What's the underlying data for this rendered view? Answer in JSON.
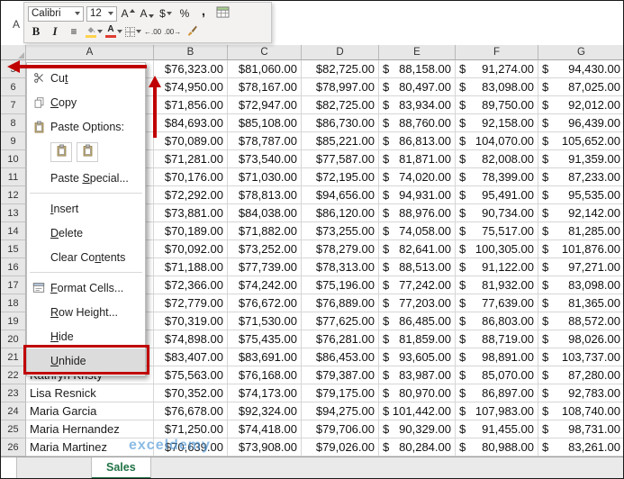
{
  "name_box_fragment": "A",
  "mini_toolbar": {
    "font_name": "Calibri",
    "font_size": "12",
    "grow_font": "A",
    "shrink_font": "A",
    "currency": "$",
    "percent": "%",
    "comma": ",",
    "bold": "B",
    "italic": "I",
    "font_color_letter": "A",
    "increase_decimal": "←.00",
    "decrease_decimal": ".00→"
  },
  "context_menu": {
    "items": [
      {
        "label": "Cut",
        "icon": "scissors",
        "u": 2
      },
      {
        "label": "Copy",
        "icon": "copy",
        "u": 0
      },
      {
        "label": "Paste Options:",
        "icon": "clipboard"
      },
      {
        "type": "paste-icons",
        "options": [
          "paste-keep-formatting",
          "paste-values"
        ]
      },
      {
        "label": "Paste Special...",
        "u": 6
      },
      {
        "type": "sep"
      },
      {
        "label": "Insert",
        "u": 0
      },
      {
        "label": "Delete",
        "u": 0
      },
      {
        "label": "Clear Contents",
        "u": 8
      },
      {
        "type": "sep"
      },
      {
        "label": "Format Cells...",
        "icon": "dialog",
        "u": 0
      },
      {
        "label": "Row Height...",
        "u": 0
      },
      {
        "label": "Hide",
        "u": 0
      },
      {
        "label": "Unhide",
        "u": 0,
        "highlighted": true
      }
    ]
  },
  "grid": {
    "columns": [
      "A",
      "B",
      "C",
      "D",
      "E",
      "F",
      "G"
    ],
    "rows": [
      {
        "n": 5,
        "name": "",
        "values": [
          "76,323.00",
          "81,060.00",
          "82,725.00",
          "88,158.00",
          "91,274.00",
          "94,430.00"
        ]
      },
      {
        "n": 6,
        "name": "",
        "values": [
          "74,950.00",
          "78,167.00",
          "78,997.00",
          "80,497.00",
          "83,098.00",
          "87,025.00"
        ]
      },
      {
        "n": 7,
        "name": "",
        "values": [
          "71,856.00",
          "72,947.00",
          "82,725.00",
          "83,934.00",
          "89,750.00",
          "92,012.00"
        ]
      },
      {
        "n": 8,
        "name": "",
        "values": [
          "84,693.00",
          "85,108.00",
          "86,730.00",
          "88,760.00",
          "92,158.00",
          "96,439.00"
        ]
      },
      {
        "n": 9,
        "name": "",
        "values": [
          "70,089.00",
          "78,787.00",
          "85,221.00",
          "86,813.00",
          "104,070.00",
          "105,652.00"
        ]
      },
      {
        "n": 10,
        "name": "",
        "values": [
          "71,281.00",
          "73,540.00",
          "77,587.00",
          "81,871.00",
          "82,008.00",
          "91,359.00"
        ]
      },
      {
        "n": 11,
        "name": "",
        "values": [
          "70,176.00",
          "71,030.00",
          "72,195.00",
          "74,020.00",
          "78,399.00",
          "87,233.00"
        ]
      },
      {
        "n": 12,
        "name": "",
        "values": [
          "72,292.00",
          "78,813.00",
          "94,656.00",
          "94,931.00",
          "95,491.00",
          "95,535.00"
        ]
      },
      {
        "n": 13,
        "name": "",
        "values": [
          "73,881.00",
          "84,038.00",
          "86,120.00",
          "88,976.00",
          "90,734.00",
          "92,142.00"
        ]
      },
      {
        "n": 14,
        "name": "",
        "values": [
          "70,189.00",
          "71,882.00",
          "73,255.00",
          "74,058.00",
          "75,517.00",
          "81,285.00"
        ]
      },
      {
        "n": 15,
        "name": "",
        "values": [
          "70,092.00",
          "73,252.00",
          "78,279.00",
          "82,641.00",
          "100,305.00",
          "101,876.00"
        ]
      },
      {
        "n": 16,
        "name": "",
        "values": [
          "71,188.00",
          "77,739.00",
          "78,313.00",
          "88,513.00",
          "91,122.00",
          "97,271.00"
        ]
      },
      {
        "n": 17,
        "name": "",
        "values": [
          "72,366.00",
          "74,242.00",
          "75,196.00",
          "77,242.00",
          "81,932.00",
          "83,098.00"
        ]
      },
      {
        "n": 18,
        "name": "",
        "values": [
          "72,779.00",
          "76,672.00",
          "76,889.00",
          "77,203.00",
          "77,639.00",
          "81,365.00"
        ]
      },
      {
        "n": 19,
        "name": "",
        "values": [
          "70,319.00",
          "71,530.00",
          "77,625.00",
          "86,485.00",
          "86,803.00",
          "88,572.00"
        ]
      },
      {
        "n": 20,
        "name": "",
        "values": [
          "74,898.00",
          "75,435.00",
          "76,281.00",
          "81,859.00",
          "88,719.00",
          "98,026.00"
        ]
      },
      {
        "n": 21,
        "name": "",
        "values": [
          "83,407.00",
          "83,691.00",
          "86,453.00",
          "93,605.00",
          "98,891.00",
          "103,737.00"
        ]
      },
      {
        "n": 22,
        "name": "Kathryn Kristy",
        "values": [
          "75,563.00",
          "76,168.00",
          "79,387.00",
          "83,987.00",
          "85,070.00",
          "87,280.00"
        ]
      },
      {
        "n": 23,
        "name": "Lisa Resnick",
        "values": [
          "70,352.00",
          "74,173.00",
          "79,175.00",
          "80,970.00",
          "86,897.00",
          "92,783.00"
        ]
      },
      {
        "n": 24,
        "name": "Maria Garcia",
        "values": [
          "76,678.00",
          "92,324.00",
          "94,275.00",
          "101,442.00",
          "107,983.00",
          "108,740.00"
        ]
      },
      {
        "n": 25,
        "name": "Maria Hernandez",
        "values": [
          "71,250.00",
          "74,418.00",
          "79,706.00",
          "90,329.00",
          "91,455.00",
          "98,731.00"
        ]
      },
      {
        "n": 26,
        "name": "Maria Martinez",
        "values": [
          "70,639.00",
          "73,908.00",
          "79,026.00",
          "80,284.00",
          "80,988.00",
          "83,261.00"
        ]
      }
    ]
  },
  "sheet_tabs": {
    "active": "Sales"
  },
  "watermark": "exceldemy",
  "colors": {
    "accent-red": "#c00000",
    "tab-green": "#217346",
    "watermark-blue": "#3f8fd4"
  }
}
